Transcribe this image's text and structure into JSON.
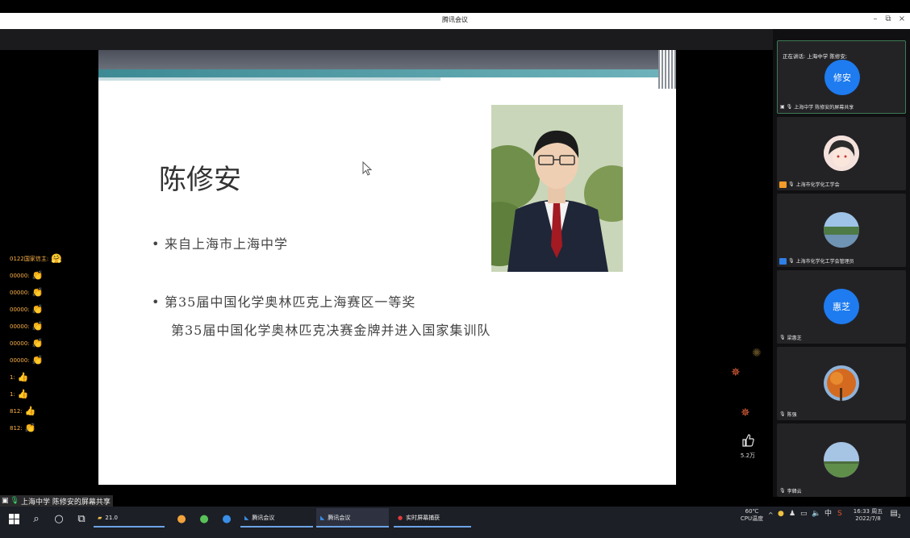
{
  "window": {
    "title": "腾讯会议"
  },
  "slide": {
    "name": "陈修安",
    "bullet1": "来自上海市上海中学",
    "bullet2_line1": "第35届中国化学奥林匹克上海赛区一等奖",
    "bullet2_line2": "第35届中国化学奥林匹克决赛金牌并进入国家集训队"
  },
  "reactions": [
    {
      "user": "0122国家信主:",
      "emoji": "🤗"
    },
    {
      "user": "00000:",
      "emoji": "👏"
    },
    {
      "user": "00000:",
      "emoji": "👏"
    },
    {
      "user": "00000:",
      "emoji": "👏"
    },
    {
      "user": "00000:",
      "emoji": "👏"
    },
    {
      "user": "00000:",
      "emoji": "👏"
    },
    {
      "user": "00000:",
      "emoji": "👏"
    },
    {
      "user": "1:",
      "emoji": "👍"
    },
    {
      "user": "1:",
      "emoji": "👍"
    },
    {
      "user": "812:",
      "emoji": "👍"
    },
    {
      "user": "812:",
      "emoji": "👏"
    }
  ],
  "like": {
    "count": "5.2万"
  },
  "share_tag": "上海中学 陈修安的屏幕共享",
  "participants": [
    {
      "speaking": "正在讲话: 上海中学 陈修安;",
      "avatar_text": "修安",
      "label": "上海中学 陈修安的屏幕共享",
      "avatar_color": "#1e7bf0"
    },
    {
      "speaking": "",
      "avatar_text": "",
      "label": "上海市化学化工学会",
      "avatar_color": "#f2d6d0"
    },
    {
      "speaking": "",
      "avatar_text": "",
      "label": "上海市化学化工学会管理员",
      "avatar_color": "#7aa9d6"
    },
    {
      "speaking": "",
      "avatar_text": "惠芝",
      "label": "梁惠芝",
      "avatar_color": "#1e7bf0"
    },
    {
      "speaking": "",
      "avatar_text": "",
      "label": "陈强",
      "avatar_color": "#d8792c"
    },
    {
      "speaking": "",
      "avatar_text": "",
      "label": "李韓云",
      "avatar_color": "#6f9c59"
    }
  ],
  "taskbar": {
    "app_folder": "21.0",
    "app_meeting1": "腾讯会议",
    "app_meeting2": "腾讯会议",
    "app_capture": "实时屏幕捕获",
    "cpu_temp": "60℃",
    "cpu_label": "CPU温度",
    "ime": "中",
    "time": "16:33 周五",
    "date": "2022/7/8",
    "notif_count": "2"
  },
  "colors": {
    "accent": "#1e7bf0",
    "teal": "#3d8a94",
    "reaction": "#ffb347"
  }
}
